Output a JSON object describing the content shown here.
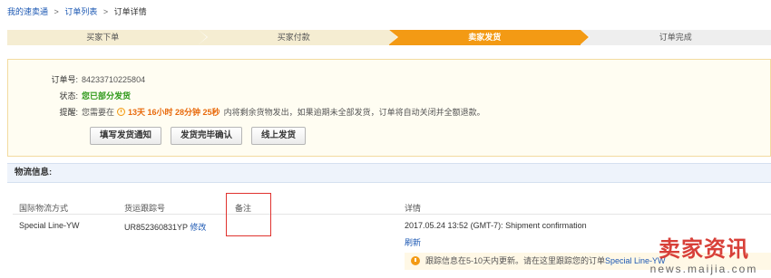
{
  "breadcrumb": {
    "home": "我的速卖通",
    "list": "订单列表",
    "separator": ">",
    "current": "订单详情"
  },
  "steps": [
    {
      "label": "买家下单",
      "state": "done"
    },
    {
      "label": "买家付款",
      "state": "done"
    },
    {
      "label": "卖家发货",
      "state": "active"
    },
    {
      "label": "订单完成",
      "state": "todo"
    }
  ],
  "order": {
    "id_label": "订单号:",
    "id_value": "84233710225804",
    "status_label": "状态:",
    "status_value": "您已部分发货",
    "reminder_label": "提醒:",
    "reminder_prefix": "您需要在",
    "countdown": "13天 16小时 28分钟 25秒",
    "reminder_suffix": "内将剩余货物发出，如果逾期未全部发货，订单将自动关闭并全额退款。"
  },
  "actions": {
    "fill_shipping_notice": "填写发货通知",
    "confirm_shipping_complete": "发货完毕确认",
    "online_shipping": "线上发货"
  },
  "logistics": {
    "header": "物流信息:",
    "columns": {
      "method": "国际物流方式",
      "tracking": "货运跟踪号",
      "remark": "备注",
      "details": "详情"
    },
    "row": {
      "method": "Special Line-YW",
      "tracking": "UR852360831YP",
      "modify": "修改",
      "detail_time": "2017.05.24 13:52 (GMT-7): Shipment confirmation",
      "refresh": "刷新"
    },
    "tip_text": "跟踪信息在5-10天内更新。请在这里跟踪您的订单",
    "tip_link": "Special Line-YW"
  },
  "watermark": {
    "main": "卖家资讯",
    "sub": "news.maijia.com"
  },
  "colors": {
    "accent": "#f39a14",
    "link": "#1c58b3",
    "status_green": "#2f9a1c",
    "highlight_red": "#e0332f"
  }
}
